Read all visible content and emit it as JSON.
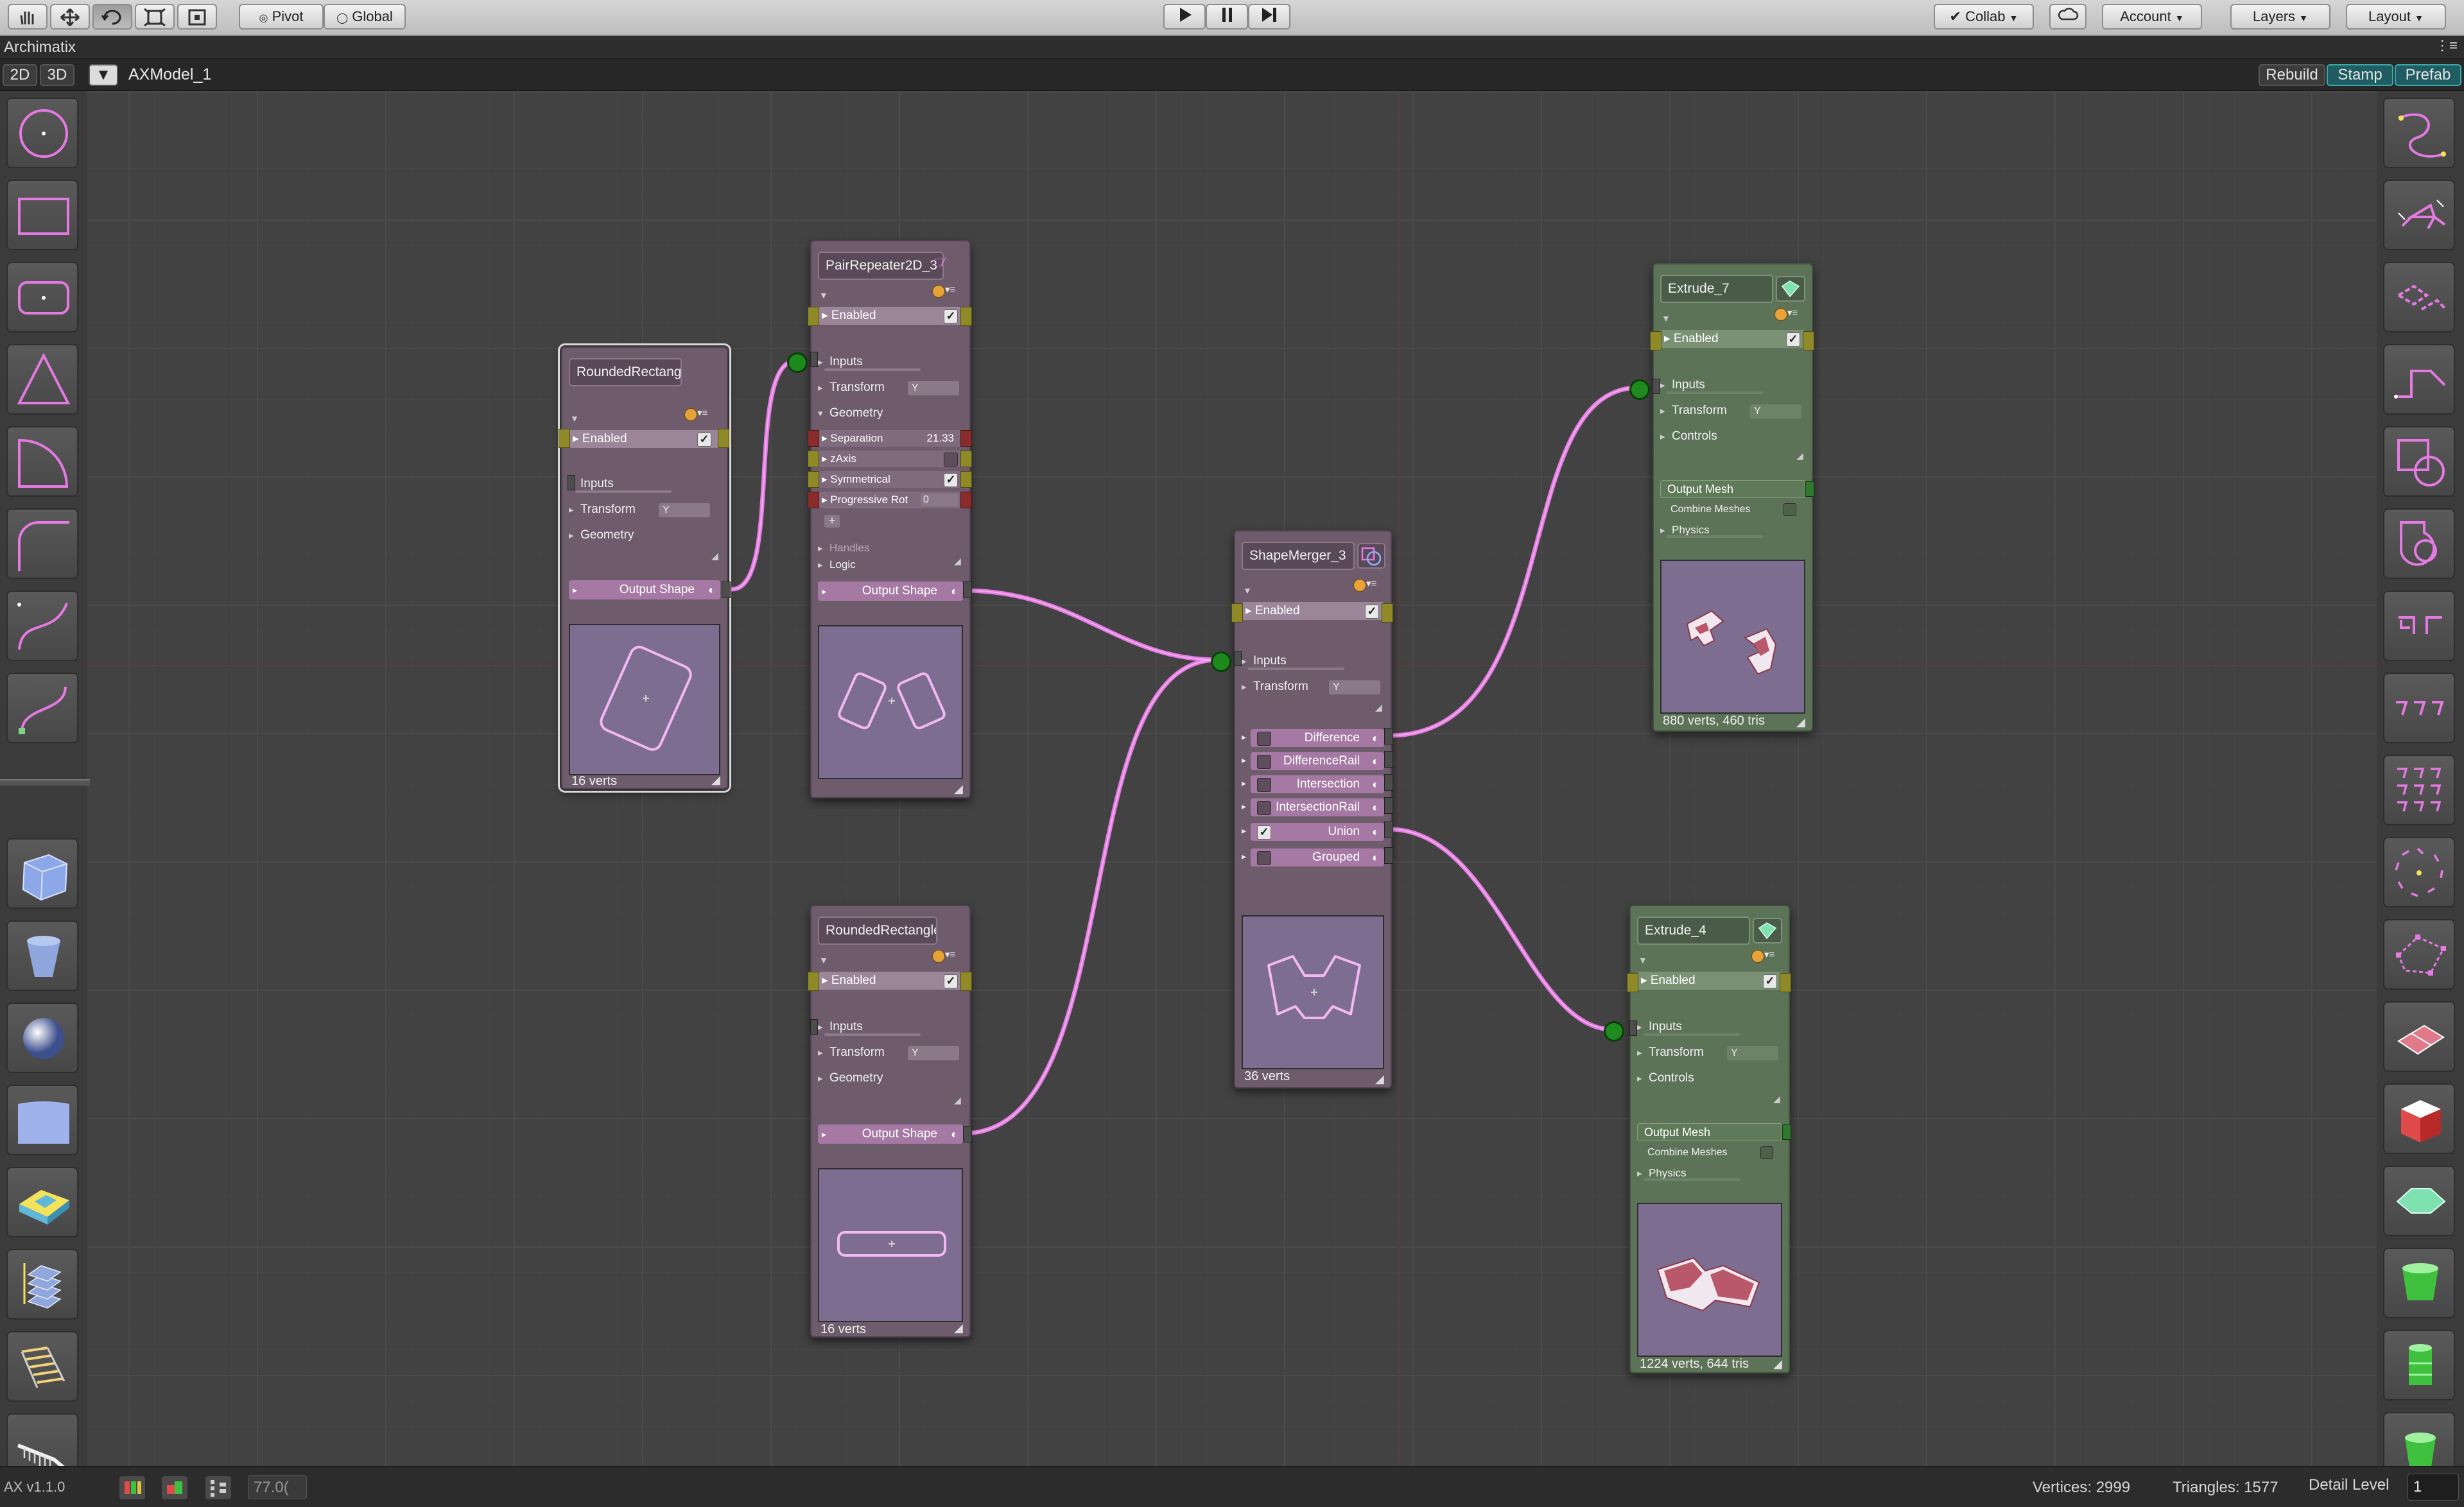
{
  "toolbar": {
    "pivot": "Pivot",
    "global": "Global",
    "collab": "Collab",
    "account": "Account",
    "layers": "Layers",
    "layout": "Layout"
  },
  "window_title": "Archimatix",
  "axbar": {
    "btn_2d": "2D",
    "btn_3d": "3D",
    "model": "AXModel_1",
    "rebuild": "Rebuild",
    "stamp": "Stamp",
    "prefab": "Prefab"
  },
  "nodes": {
    "rr1": {
      "title": "RoundedRectangle",
      "enabled": "Enabled",
      "inputs": "Inputs",
      "transform": "Transform",
      "transform_axis": "Y",
      "geometry": "Geometry",
      "output": "Output Shape",
      "footer": "16 verts"
    },
    "pair": {
      "title": "PairRepeater2D_3",
      "enabled": "Enabled",
      "inputs": "Inputs",
      "transform": "Transform",
      "transform_axis": "Y",
      "geometry": "Geometry",
      "separation": "Separation",
      "separation_value": "21.33",
      "zaxis": "zAxis",
      "symmetrical": "Symmetrical",
      "progressive": "Progressive Rot",
      "progressive_value": "0",
      "plus": "+",
      "handles": "Handles",
      "logic": "Logic",
      "output": "Output Shape"
    },
    "rr2": {
      "title": "RoundedRectangle",
      "enabled": "Enabled",
      "inputs": "Inputs",
      "transform": "Transform",
      "transform_axis": "Y",
      "geometry": "Geometry",
      "output": "Output Shape",
      "footer": "16 verts"
    },
    "merger": {
      "title": "ShapeMerger_3",
      "enabled": "Enabled",
      "inputs": "Inputs",
      "transform": "Transform",
      "transform_axis": "Y",
      "ops": [
        "Difference",
        "DifferenceRail",
        "Intersection",
        "IntersectionRail",
        "Union",
        "Grouped"
      ],
      "footer": "36 verts"
    },
    "ex7": {
      "title": "Extrude_7",
      "enabled": "Enabled",
      "inputs": "Inputs",
      "transform": "Transform",
      "transform_axis": "Y",
      "controls": "Controls",
      "output": "Output Mesh",
      "combine": "Combine Meshes",
      "physics": "Physics",
      "footer": "880 verts, 460 tris"
    },
    "ex4": {
      "title": "Extrude_4",
      "enabled": "Enabled",
      "inputs": "Inputs",
      "transform": "Transform",
      "transform_axis": "Y",
      "controls": "Controls",
      "output": "Output Mesh",
      "combine": "Combine Meshes",
      "physics": "Physics",
      "footer": "1224 verts, 644 tris"
    }
  },
  "status": {
    "version": "AX v1.1.0",
    "zoom": "77.0(",
    "vertices": "Vertices: 2999",
    "triangles": "Triangles: 1577",
    "detail_label": "Detail Level",
    "detail_value": "1"
  },
  "colors": {
    "shape_node": "#6e5c6d",
    "mesh_node": "#5d7358",
    "wire": "#e47ae2",
    "accent_teal": "#3aa8a8"
  }
}
